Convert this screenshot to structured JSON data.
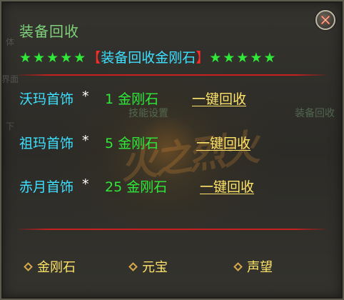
{
  "window": {
    "title": "装备回收",
    "close_label": "close"
  },
  "header": {
    "stars_left": "★★★★★",
    "bracket_open": "【",
    "heading": "装备回收金刚石",
    "bracket_close": "】",
    "stars_right": "★★★★★"
  },
  "recycle_rows": [
    {
      "name": "沃玛首饰",
      "multiplier": "*",
      "cost": "1 金刚石",
      "action": "一键回收"
    },
    {
      "name": "祖玛首饰",
      "multiplier": "*",
      "cost": "5 金刚石",
      "action": "一键回收"
    },
    {
      "name": "赤月首饰",
      "multiplier": "*",
      "cost": "25 金刚石",
      "action": "一键回收"
    }
  ],
  "currencies": [
    {
      "label": "金刚石"
    },
    {
      "label": "元宝"
    },
    {
      "label": "声望"
    }
  ],
  "background_ghost": {
    "skill_text": "技能设置",
    "recycle_text": "装备回收",
    "left_1": "体",
    "left_2": "界面",
    "left_3": "下",
    "art_text": "火之烈火"
  },
  "colors": {
    "title_green": "#7fd07a",
    "item_cyan": "#3ee0ff",
    "cost_green": "#2fe83a",
    "action_yellow": "#ffe46a",
    "bracket_red": "#ff2a2a",
    "divider_red": "#c8201f"
  }
}
